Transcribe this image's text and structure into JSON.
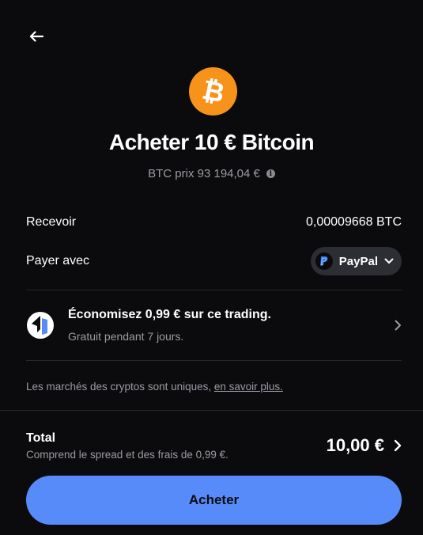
{
  "header": {
    "back_icon": "arrow-left-icon",
    "coin_icon": "bitcoin-icon",
    "coin_glyph": "₿",
    "coin_color": "#f7931a",
    "title": "Acheter 10 € Bitcoin",
    "price_text": "BTC prix 93 194,04 €",
    "info_icon": "info-icon"
  },
  "receive": {
    "label": "Recevoir",
    "value": "0,00009668 BTC"
  },
  "payment": {
    "label": "Payer avec",
    "method": "PayPal",
    "method_icon": "paypal-icon",
    "chevron_icon": "chevron-down-icon"
  },
  "promo": {
    "icon": "coinbase-one-icon",
    "title": "Économisez 0,99 € sur ce trading.",
    "subtitle": "Gratuit pendant 7 jours.",
    "chevron_icon": "chevron-right-icon"
  },
  "disclaimer": {
    "text": "Les marchés des cryptos sont uniques, ",
    "link": "en savoir plus."
  },
  "total": {
    "label": "Total",
    "subtitle": "Comprend le spread et des frais de 0,99 €.",
    "value": "10,00 €",
    "chevron_icon": "chevron-right-icon"
  },
  "cta": {
    "label": "Acheter",
    "color": "#578bfa"
  }
}
